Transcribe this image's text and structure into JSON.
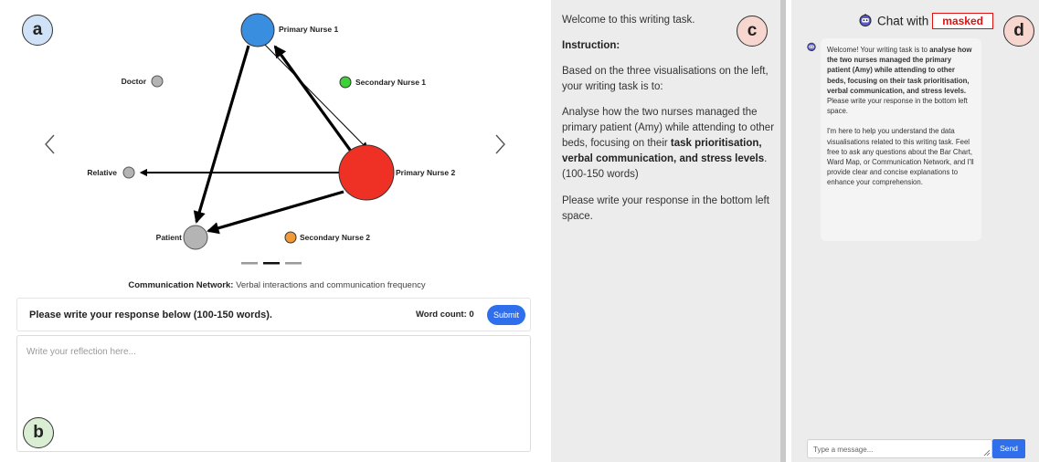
{
  "viz": {
    "nodes": {
      "primary_nurse_1": "Primary Nurse 1",
      "secondary_nurse_1": "Secondary Nurse 1",
      "doctor": "Doctor",
      "relative": "Relative",
      "primary_nurse_2": "Primary Nurse 2",
      "patient": "Patient",
      "secondary_nurse_2": "Secondary Nurse 2"
    },
    "node_colors": {
      "primary_nurse_1": "#3a8ee0",
      "secondary_nurse_1": "#3ed13a",
      "doctor": "#b4b4b4",
      "relative": "#b4b4b4",
      "primary_nurse_2": "#ee3124",
      "patient": "#b4b4b4",
      "secondary_nurse_2": "#f29a38"
    },
    "caption_bold": "Communication Network:",
    "caption_rest": " Verbal interactions and communication frequency",
    "carousel_active_index": 1,
    "carousel_count": 3
  },
  "response": {
    "title": "Please write your response below (100-150 words).",
    "word_count": "Word count: 0",
    "submit": "Submit",
    "placeholder": "Write your reflection here..."
  },
  "badges": {
    "a": "a",
    "b": "b",
    "c": "c",
    "d": "d"
  },
  "instructions": {
    "welcome": "Welcome to this writing task.",
    "heading": "Instruction:",
    "intro": "Based on the three visualisations on the left, your writing task is to:",
    "task_pre": "Analyse how the two nurses managed the primary patient (Amy) while attending to other beds, focusing on their ",
    "task_bold": "task prioritisation, verbal communication, and stress levels",
    "task_post": ". (100-150 words)",
    "closing": "Please write your response in the bottom left space."
  },
  "chat": {
    "title": "Chat with",
    "masked": "masked",
    "msg_pre": "Welcome! Your writing task is to ",
    "msg_bold": "analyse how the two nurses managed the primary patient (Amy) while attending to other beds, focusing on their task prioritisation, verbal communication, and stress levels.",
    "msg_post": " Please write your response in the bottom left space.",
    "msg_second": "I'm here to help you understand the data visualisations related to this writing task. Feel free to ask any questions about the Bar Chart, Ward Map, or Communication Network, and I'll provide clear and concise explanations to enhance your comprehension.",
    "input_placeholder": "Type a message...",
    "send": "Send"
  },
  "icons": {
    "prev": "chevron-left-icon",
    "next": "chevron-right-icon",
    "bot": "robot-icon",
    "resize": "resize-grip-icon"
  }
}
